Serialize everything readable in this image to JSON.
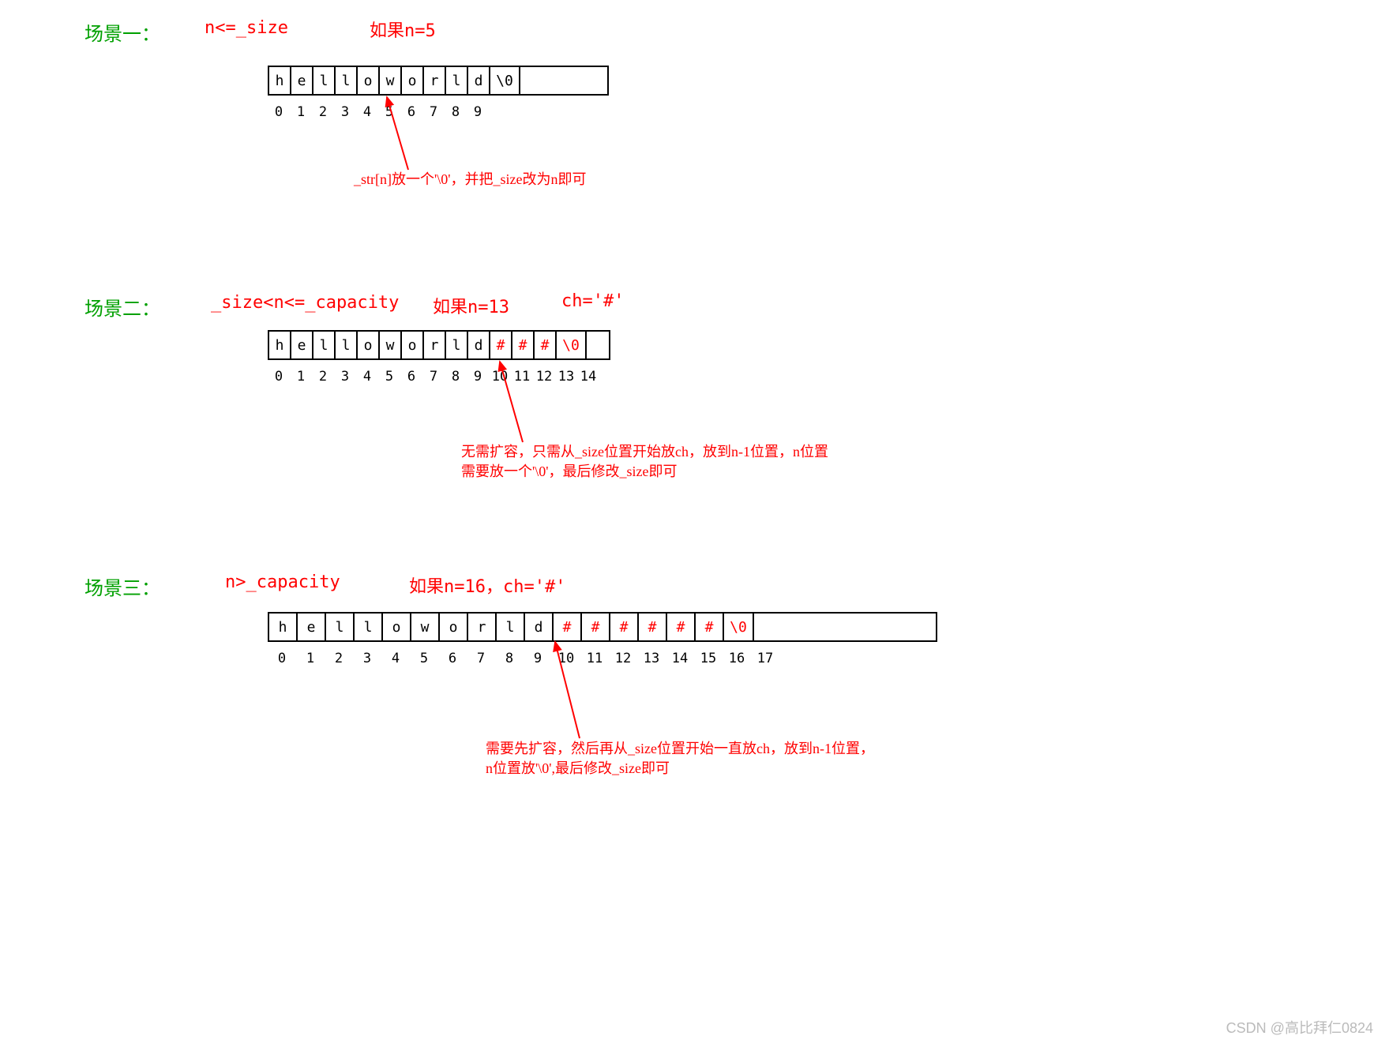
{
  "scenario1": {
    "title": "场景一：",
    "condition": "n<=_size",
    "example": "如果n=5",
    "cells": [
      "h",
      "e",
      "l",
      "l",
      "o",
      "w",
      "o",
      "r",
      "l",
      "d",
      "\\0"
    ],
    "indices": [
      "0",
      "1",
      "2",
      "3",
      "4",
      "5",
      "6",
      "7",
      "8",
      "9"
    ],
    "arrow_annotation": "_str[n]放一个'\\0'，并把_size改为n即可"
  },
  "scenario2": {
    "title": "场景二：",
    "condition": "_size<n<=_capacity",
    "example": "如果n=13",
    "ch": "ch='#'",
    "cells": [
      "h",
      "e",
      "l",
      "l",
      "o",
      "w",
      "o",
      "r",
      "l",
      "d",
      "#",
      "#",
      "#",
      "\\0"
    ],
    "indices": [
      "0",
      "1",
      "2",
      "3",
      "4",
      "5",
      "6",
      "7",
      "8",
      "9",
      "10",
      "11",
      "12",
      "13",
      "14"
    ],
    "arrow_annotation_line1": "无需扩容，只需从_size位置开始放ch，放到n-1位置，n位置",
    "arrow_annotation_line2": "需要放一个'\\0'，最后修改_size即可"
  },
  "scenario3": {
    "title": "场景三：",
    "condition": "n>_capacity",
    "example": "如果n=16，ch='#'",
    "cells": [
      "h",
      "e",
      "l",
      "l",
      "o",
      "w",
      "o",
      "r",
      "l",
      "d",
      "#",
      "#",
      "#",
      "#",
      "#",
      "#",
      "\\0"
    ],
    "indices": [
      "0",
      "1",
      "2",
      "3",
      "4",
      "5",
      "6",
      "7",
      "8",
      "9",
      "10",
      "11",
      "12",
      "13",
      "14",
      "15",
      "16",
      "17"
    ],
    "arrow_annotation_line1": "需要先扩容，然后再从_size位置开始一直放ch，放到n-1位置，",
    "arrow_annotation_line2": "n位置放'\\0',最后修改_size即可"
  },
  "watermark": "CSDN @高比拜仁0824"
}
